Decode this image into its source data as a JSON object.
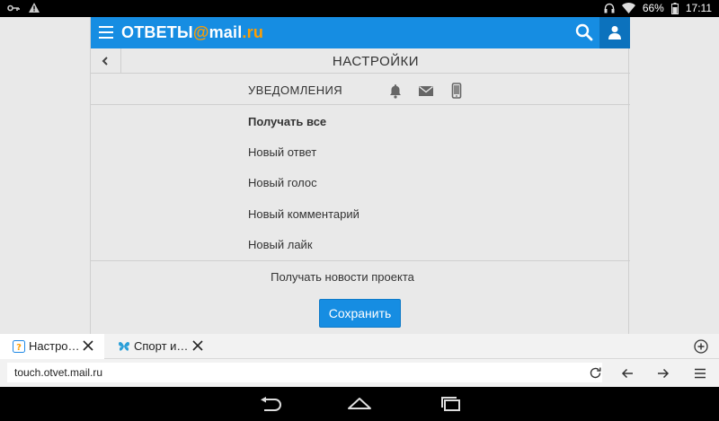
{
  "status_bar": {
    "battery": "66%",
    "time": "17:11",
    "icons": [
      "key-icon",
      "warning-icon",
      "headphones-icon",
      "wifi-icon",
      "battery-icon"
    ]
  },
  "app": {
    "logo_otvety": "ОТВЕТЫ",
    "logo_at": "@",
    "logo_mail": "mail",
    "logo_ru": ".ru",
    "brand_color": "#168de2",
    "accent_color": "#ff9e00"
  },
  "settings": {
    "title": "НАСТРОЙКИ",
    "section_label": "УВЕДОМЛЕНИЯ",
    "tab_icons": [
      "bell-icon",
      "envelope-icon",
      "phone-icon"
    ],
    "options": [
      {
        "label": "Получать все"
      },
      {
        "label": "Новый ответ"
      },
      {
        "label": "Новый голос"
      },
      {
        "label": "Новый комментарий"
      },
      {
        "label": "Новый лайк"
      }
    ],
    "news_label": "Получать новости проекта",
    "save_label": "Сохранить"
  },
  "browser": {
    "tabs": [
      {
        "label": "Настро…",
        "favicon": "question-favicon"
      },
      {
        "label": "Спорт и…",
        "favicon": "butterfly-favicon"
      }
    ],
    "url": "touch.otvet.mail.ru"
  }
}
